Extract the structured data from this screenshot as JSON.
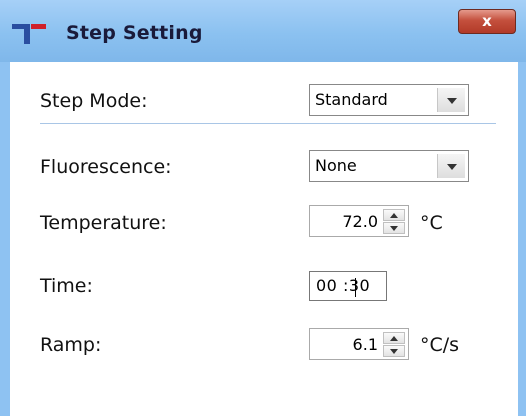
{
  "window": {
    "title": "Step Setting",
    "close_label": "x"
  },
  "fields": {
    "step_mode": {
      "label": "Step Mode:",
      "value": "Standard"
    },
    "fluorescence": {
      "label": "Fluorescence:",
      "value": "None"
    },
    "temperature": {
      "label": "Temperature:",
      "value": "72.0",
      "unit": "°C"
    },
    "time": {
      "label": "Time:",
      "value": "00 :30"
    },
    "ramp": {
      "label": "Ramp:",
      "value": "6.1",
      "unit": "°C/s"
    }
  },
  "colors": {
    "titlebar": "#8ec2f2",
    "close_button": "#c4503d",
    "logo_blue": "#2a4ea0",
    "logo_red": "#d0202a"
  },
  "icons": {
    "app": "app-logo-icon",
    "close": "close-icon"
  }
}
